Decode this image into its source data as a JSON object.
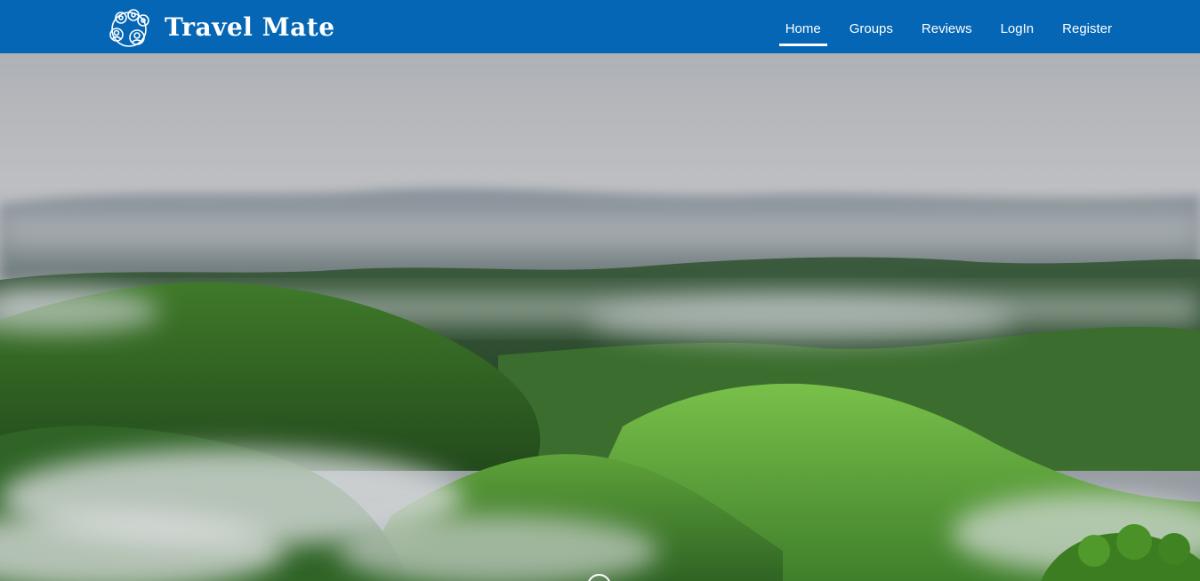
{
  "brand": {
    "name": "Travel Mate",
    "logo_icon": "travel-group-logo-icon"
  },
  "nav": {
    "items": [
      {
        "label": "Home",
        "active": true
      },
      {
        "label": "Groups",
        "active": false
      },
      {
        "label": "Reviews",
        "active": false
      },
      {
        "label": "LogIn",
        "active": false
      },
      {
        "label": "Register",
        "active": false
      }
    ]
  },
  "hero": {
    "image": "misty green hills landscape",
    "scroll_icon": "mouse-scroll-icon"
  },
  "colors": {
    "navbar": "#0466b4",
    "nav_text": "#ffffff"
  }
}
